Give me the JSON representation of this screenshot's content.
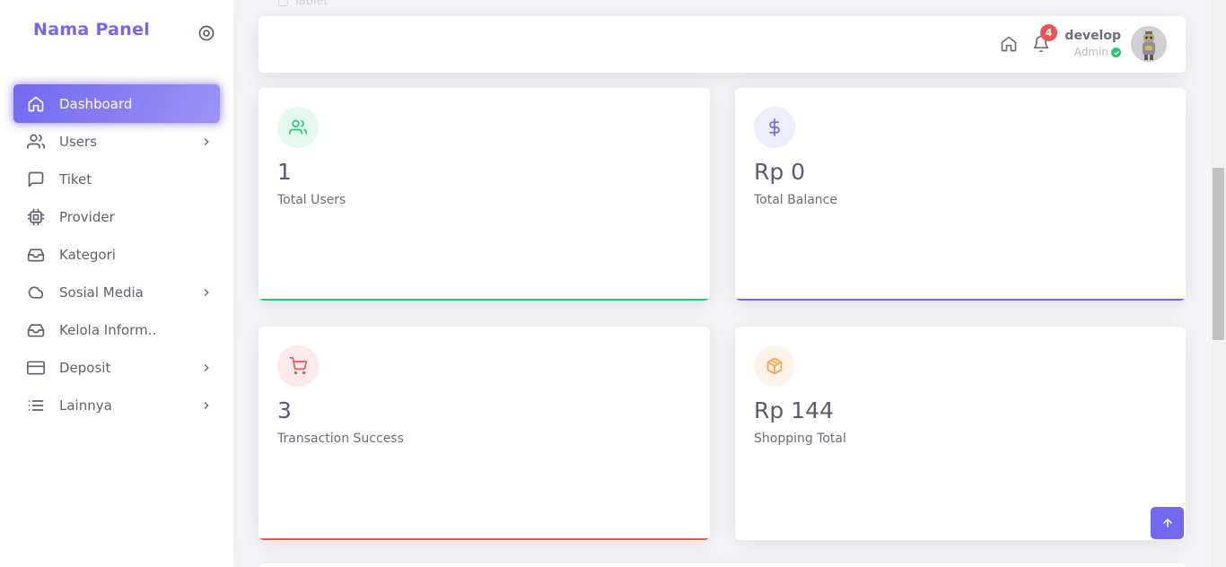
{
  "brand": {
    "name": "Nama Panel"
  },
  "sidebar": {
    "items": [
      {
        "label": "Dashboard",
        "icon": "home-icon",
        "active": true,
        "has_children": false
      },
      {
        "label": "Users",
        "icon": "users-icon",
        "active": false,
        "has_children": true
      },
      {
        "label": "Tiket",
        "icon": "message-square-icon",
        "active": false,
        "has_children": false
      },
      {
        "label": "Provider",
        "icon": "cpu-icon",
        "active": false,
        "has_children": false
      },
      {
        "label": "Kategori",
        "icon": "inbox-icon",
        "active": false,
        "has_children": false
      },
      {
        "label": "Sosial Media",
        "icon": "cloud-icon",
        "active": false,
        "has_children": true
      },
      {
        "label": "Kelola Inform..",
        "icon": "inbox-icon",
        "active": false,
        "has_children": false
      },
      {
        "label": "Deposit",
        "icon": "credit-card-icon",
        "active": false,
        "has_children": true
      },
      {
        "label": "Lainnya",
        "icon": "list-icon",
        "active": false,
        "has_children": true
      }
    ]
  },
  "header": {
    "peek_text": "Tablet",
    "notification_count": "4",
    "user": {
      "name": "develop",
      "role": "Admin"
    }
  },
  "stats": [
    {
      "value": "1",
      "label": "Total Users",
      "icon": "users-icon",
      "accent": "#28c76f",
      "icon_bg": "#e5f8ed"
    },
    {
      "value": "Rp 0",
      "label": "Total Balance",
      "icon": "dollar-icon",
      "accent": "#7367f0",
      "icon_bg": "#eeedfd"
    },
    {
      "value": "3",
      "label": "Transaction Success",
      "icon": "cart-icon",
      "accent": "#ea5455",
      "icon_bg": "#fceaea"
    },
    {
      "value": "Rp 144",
      "label": "Shopping Total",
      "icon": "package-icon",
      "accent": "#ff9f43",
      "icon_bg": "#fff3e8"
    }
  ],
  "colors": {
    "primary": "#7367f0",
    "success": "#28c76f",
    "danger": "#ea5455",
    "warning": "#ff9f43"
  }
}
